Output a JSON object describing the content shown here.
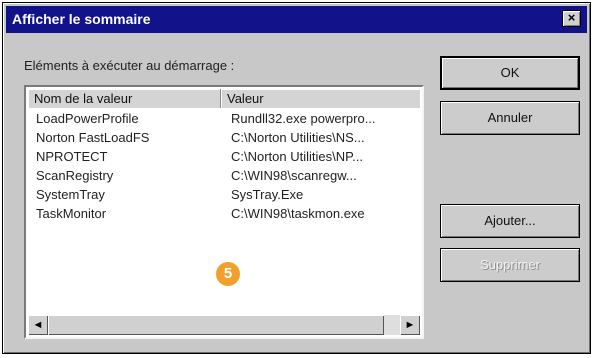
{
  "window": {
    "title": "Afficher le sommaire",
    "close_glyph": "×"
  },
  "list": {
    "caption": "Eléments à exécuter au démarrage :",
    "columns": [
      "Nom de la valeur",
      "Valeur"
    ],
    "rows": [
      {
        "name": "LoadPowerProfile",
        "value": "Rundll32.exe powerpro..."
      },
      {
        "name": "Norton FastLoadFS",
        "value": "C:\\Norton Utilities\\NS..."
      },
      {
        "name": "NPROTECT",
        "value": "C:\\Norton Utilities\\NP..."
      },
      {
        "name": "ScanRegistry",
        "value": "C:\\WIN98\\scanregw..."
      },
      {
        "name": "SystemTray",
        "value": "SysTray.Exe"
      },
      {
        "name": "TaskMonitor",
        "value": "C:\\WIN98\\taskmon.exe"
      }
    ],
    "scroll_left_glyph": "◄",
    "scroll_right_glyph": "►"
  },
  "buttons": {
    "ok": "OK",
    "cancel": "Annuler",
    "add": "Ajouter...",
    "remove": "Supprimer"
  },
  "badge": {
    "number": "5",
    "color": "#f0a02c"
  },
  "colors": {
    "titlebar": "#12128a",
    "dialog_face": "#c8c8c8"
  },
  "icons": {
    "close": "close-icon",
    "scroll_left": "scroll-left-arrow-icon",
    "scroll_right": "scroll-right-arrow-icon"
  }
}
